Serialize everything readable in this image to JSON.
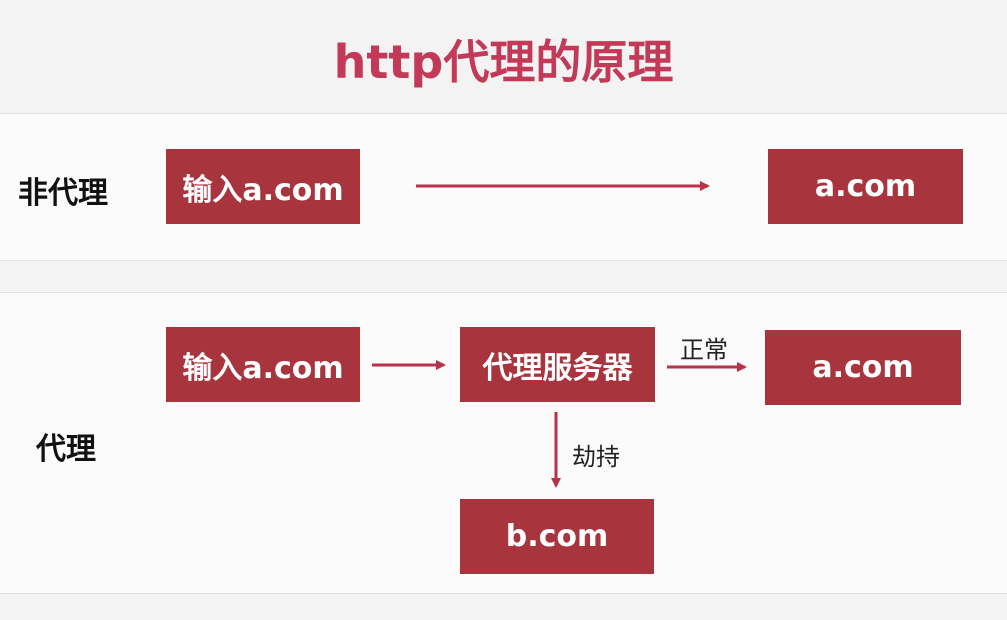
{
  "title": "http代理的原理",
  "rows": {
    "direct": {
      "label": "非代理",
      "input_box": "输入a.com",
      "target_box": "a.com"
    },
    "proxy": {
      "label": "代理",
      "input_box": "输入a.com",
      "proxy_box": "代理服务器",
      "normal_label": "正常",
      "normal_target_box": "a.com",
      "hijack_label": "劫持",
      "hijack_target_box": "b.com"
    }
  },
  "colors": {
    "title": "#c23a57",
    "box_fill": "#a8353e",
    "arrow": "#b8324a"
  }
}
